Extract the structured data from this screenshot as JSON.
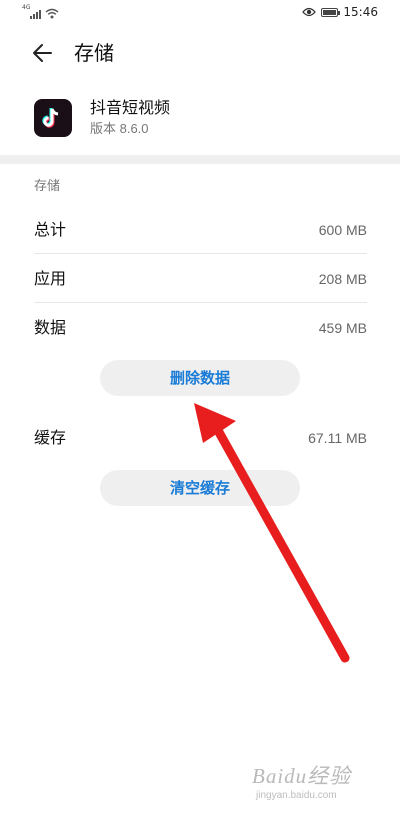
{
  "status_bar": {
    "network": "4G",
    "time": "15:46",
    "icons": [
      "signal-icon",
      "wifi-icon",
      "eye-icon",
      "battery-icon"
    ],
    "battery_level": 0.85
  },
  "header": {
    "title": "存储",
    "back_icon": "arrow-left-icon"
  },
  "app": {
    "name": "抖音短视频",
    "version": "版本 8.6.0",
    "icon": "tiktok-icon"
  },
  "storage": {
    "section_title": "存储",
    "rows": [
      {
        "label": "总计",
        "value": "600 MB"
      },
      {
        "label": "应用",
        "value": "208 MB"
      },
      {
        "label": "数据",
        "value": "459 MB"
      }
    ],
    "clear_data_label": "删除数据",
    "cache": {
      "label": "缓存",
      "value": "67.11 MB"
    },
    "clear_cache_label": "清空缓存"
  },
  "annotation": {
    "arrow_color": "#e81d1d"
  },
  "watermark": {
    "logo": "Baidu经验",
    "url": "jingyan.baidu.com"
  },
  "colors": {
    "accent": "#1a7cd6",
    "band": "#efefef"
  }
}
